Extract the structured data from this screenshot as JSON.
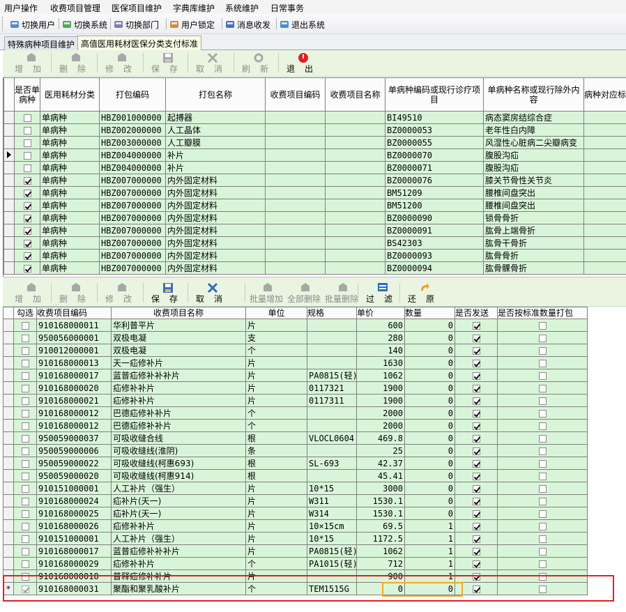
{
  "menu": [
    "用户操作",
    "收费项目管理",
    "医保项目维护",
    "字典库维护",
    "系统维护",
    "日常事务"
  ],
  "quickbar": [
    {
      "label": "切换用户",
      "icon": "switch-user-icon"
    },
    {
      "label": "切换系统",
      "icon": "switch-system-icon"
    },
    {
      "label": "切换部门",
      "icon": "switch-department-icon"
    },
    {
      "label": "用户锁定",
      "icon": "user-lock-icon"
    },
    {
      "label": "消息收发",
      "icon": "message-icon"
    },
    {
      "label": "退出系统",
      "icon": "exit-system-icon"
    }
  ],
  "tabs": [
    "特殊病种项目维护",
    "高值医用耗材医保分类支付标准"
  ],
  "toolbar1": [
    {
      "label": "增加",
      "enabled": false
    },
    {
      "label": "删除",
      "enabled": false
    },
    {
      "label": "修改",
      "enabled": false
    },
    {
      "label": "保存",
      "enabled": false
    },
    {
      "label": "取消",
      "enabled": false
    },
    {
      "label": "刷新",
      "enabled": false
    },
    {
      "label": "退出",
      "enabled": true
    }
  ],
  "grid1": {
    "headers": [
      "是否单病种",
      "医用耗材分类",
      "打包编码",
      "打包名称",
      "收费项目编码",
      "收费项目名称",
      "单病种编码或现行诊疗项目",
      "单病种名称或现行除外内容",
      "病种对应标"
    ],
    "rows": [
      {
        "checked": false,
        "cat": "单病种",
        "code": "HBZ001000000",
        "name": "起搏器",
        "disease_code": "BI49510",
        "disease_name": "病态窦房结综合症"
      },
      {
        "checked": false,
        "cat": "单病种",
        "code": "HBZ002000000",
        "name": "人工晶体",
        "disease_code": "BZ0000053",
        "disease_name": "老年性白内障"
      },
      {
        "checked": false,
        "cat": "单病种",
        "code": "HBZ003000000",
        "name": "人工瓣膜",
        "disease_code": "BZ0000055",
        "disease_name": "风湿性心脏病二尖瓣病变"
      },
      {
        "checked": false,
        "cat": "单病种",
        "code": "HBZ004000000",
        "name": "补片",
        "disease_code": "BZ0000070",
        "disease_name": "腹股沟疝",
        "current": true
      },
      {
        "checked": false,
        "cat": "单病种",
        "code": "HBZ004000000",
        "name": "补片",
        "disease_code": "BZ0000071",
        "disease_name": "腹股沟疝"
      },
      {
        "checked": true,
        "cat": "单病种",
        "code": "HBZ007000000",
        "name": "内外固定材料",
        "disease_code": "BZ0000076",
        "disease_name": "膝关节骨性关节炎"
      },
      {
        "checked": true,
        "cat": "单病种",
        "code": "HBZ007000000",
        "name": "内外固定材料",
        "disease_code": "BM51209",
        "disease_name": "腰椎间盘突出"
      },
      {
        "checked": true,
        "cat": "单病种",
        "code": "HBZ007000000",
        "name": "内外固定材料",
        "disease_code": "BM51200",
        "disease_name": "腰椎间盘突出"
      },
      {
        "checked": true,
        "cat": "单病种",
        "code": "HBZ007000000",
        "name": "内外固定材料",
        "disease_code": "BZ0000090",
        "disease_name": "锁骨骨折"
      },
      {
        "checked": true,
        "cat": "单病种",
        "code": "HBZ007000000",
        "name": "内外固定材料",
        "disease_code": "BZ0000091",
        "disease_name": "肱骨上端骨折"
      },
      {
        "checked": true,
        "cat": "单病种",
        "code": "HBZ007000000",
        "name": "内外固定材料",
        "disease_code": "BS42303",
        "disease_name": "肱骨干骨折"
      },
      {
        "checked": true,
        "cat": "单病种",
        "code": "HBZ007000000",
        "name": "内外固定材料",
        "disease_code": "BZ0000093",
        "disease_name": "肱骨骨折"
      },
      {
        "checked": true,
        "cat": "单病种",
        "code": "HBZ007000000",
        "name": "内外固定材料",
        "disease_code": "BZ0000094",
        "disease_name": "肱骨髁骨折"
      }
    ]
  },
  "toolbar2": [
    {
      "label": "增加",
      "enabled": false
    },
    {
      "label": "删除",
      "enabled": false
    },
    {
      "label": "修改",
      "enabled": false
    },
    {
      "label": "保存",
      "enabled": true
    },
    {
      "label": "取消",
      "enabled": true
    },
    {
      "label": "批量增加",
      "enabled": false
    },
    {
      "label": "全部删除",
      "enabled": false
    },
    {
      "label": "批量删除",
      "enabled": false
    },
    {
      "label": "过滤",
      "enabled": true
    },
    {
      "label": "还原",
      "enabled": true
    }
  ],
  "grid2": {
    "headers": [
      "勾选",
      "收费项目编码",
      "收费项目名称",
      "单位",
      "规格",
      "单价",
      "数量",
      "是否发送",
      "是否按标准数量打包"
    ],
    "rows": [
      {
        "code": "910168000011",
        "name": "华利普平片",
        "unit": "片",
        "spec": "",
        "price": "600",
        "qty": "0",
        "send": true
      },
      {
        "code": "950056000001",
        "name": "双极电凝",
        "unit": "支",
        "spec": "",
        "price": "280",
        "qty": "0",
        "send": true
      },
      {
        "code": "910012000001",
        "name": "双极电凝",
        "unit": "个",
        "spec": "",
        "price": "140",
        "qty": "0",
        "send": true
      },
      {
        "code": "910168000013",
        "name": "天一疝修补片",
        "unit": "片",
        "spec": "",
        "price": "1630",
        "qty": "0",
        "send": true
      },
      {
        "code": "910168000017",
        "name": "蓝普疝修补补补片",
        "unit": "片",
        "spec": "PA0815(轻)",
        "price": "1062",
        "qty": "0",
        "send": true
      },
      {
        "code": "910168000020",
        "name": "疝修补补片",
        "unit": "片",
        "spec": "0117321",
        "price": "1900",
        "qty": "0",
        "send": true
      },
      {
        "code": "910168000021",
        "name": "疝修补补片",
        "unit": "片",
        "spec": "0117311",
        "price": "1900",
        "qty": "0",
        "send": true
      },
      {
        "code": "910168000012",
        "name": "巴德疝修补补片",
        "unit": "个",
        "spec": "",
        "price": "2000",
        "qty": "0",
        "send": true
      },
      {
        "code": "910168000012",
        "name": "巴德疝修补补片",
        "unit": "个",
        "spec": "",
        "price": "2000",
        "qty": "0",
        "send": true
      },
      {
        "code": "950059000037",
        "name": "可吸收缝合线",
        "unit": "根",
        "spec": "VLOCL0604",
        "price": "469.8",
        "qty": "0",
        "send": true
      },
      {
        "code": "950059000006",
        "name": "可吸收缝线(淮阴)",
        "unit": "条",
        "spec": "",
        "price": "25",
        "qty": "0",
        "send": true
      },
      {
        "code": "950059000022",
        "name": "可吸收缝线(柯惠693)",
        "unit": "根",
        "spec": "SL-693",
        "price": "42.37",
        "qty": "0",
        "send": true
      },
      {
        "code": "950059000020",
        "name": "可吸收缝线(柯惠914)",
        "unit": "根",
        "spec": "",
        "price": "45.41",
        "qty": "0",
        "send": true
      },
      {
        "code": "910151000001",
        "name": "人工补片（强生）",
        "unit": "片",
        "spec": "10*15",
        "price": "3000",
        "qty": "0",
        "send": true
      },
      {
        "code": "910168000024",
        "name": "疝补片(天一)",
        "unit": "片",
        "spec": "W311",
        "price": "1530.1",
        "qty": "0",
        "send": true
      },
      {
        "code": "910168000025",
        "name": "疝补片(天一)",
        "unit": "片",
        "spec": "W314",
        "price": "1530.1",
        "qty": "0",
        "send": true
      },
      {
        "code": "910168000026",
        "name": "疝修补补片",
        "unit": "片",
        "spec": "10×15cm",
        "price": "69.5",
        "qty": "1",
        "send": true
      },
      {
        "code": "910151000001",
        "name": "人工补片（强生）",
        "unit": "片",
        "spec": "10*15",
        "price": "1172.5",
        "qty": "1",
        "send": true
      },
      {
        "code": "910168000017",
        "name": "蓝普疝修补补补片",
        "unit": "片",
        "spec": "PA0815(轻)",
        "price": "1062",
        "qty": "1",
        "send": true
      },
      {
        "code": "910168000029",
        "name": "疝修补补片",
        "unit": "个",
        "spec": "PA1015(轻)",
        "price": "712",
        "qty": "1",
        "send": true
      },
      {
        "code": "910168000018",
        "name": "普释疝修补补片",
        "unit": "片",
        "spec": "",
        "price": "900",
        "qty": "1",
        "send": true
      },
      {
        "code": "910168000031",
        "name": "聚酯和聚乳酸补片",
        "unit": "个",
        "spec": "TEM1515G",
        "price": "0",
        "qty": "0",
        "send": true,
        "new": true,
        "row_checked": true
      }
    ]
  }
}
